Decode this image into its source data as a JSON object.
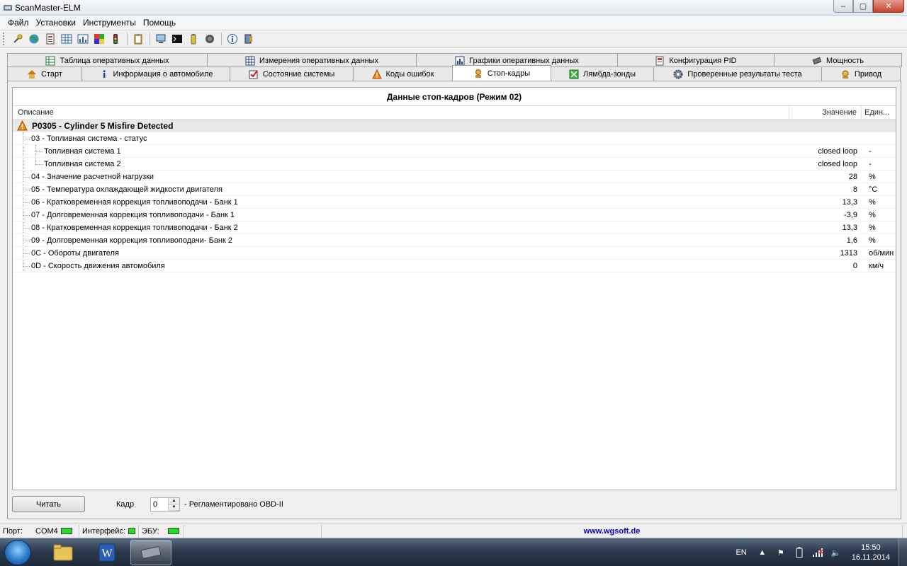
{
  "window": {
    "title": "ScanMaster-ELM",
    "minimize_glyph": "–",
    "restore_glyph": "▢",
    "close_glyph": "✕"
  },
  "menu": [
    "Файл",
    "Установки",
    "Инструменты",
    "Помощь"
  ],
  "toolbar_icons": [
    "connect-icon",
    "globe-icon",
    "report-icon",
    "table-icon",
    "chart-icon",
    "palette-icon",
    "traffic-light-icon",
    "clipboard-icon",
    "pc-icon",
    "terminal-icon",
    "battery-icon",
    "record-icon",
    "info-icon",
    "exit-icon"
  ],
  "tabs": {
    "row1": [
      {
        "label": "Таблица оперативных данных",
        "icon": "table-icon"
      },
      {
        "label": "Измерения оперативных данных",
        "icon": "grid-icon"
      },
      {
        "label": "Графики оперативных данных",
        "icon": "chart-icon"
      },
      {
        "label": "Конфигурация PID",
        "icon": "config-icon"
      },
      {
        "label": "Мощность",
        "icon": "chip-icon"
      }
    ],
    "row2": [
      {
        "label": "Старт",
        "icon": "home-icon"
      },
      {
        "label": "Информация о автомобиле",
        "icon": "info-icon"
      },
      {
        "label": "Состояние системы",
        "icon": "status-icon"
      },
      {
        "label": "Коды ошибок",
        "icon": "warning-icon"
      },
      {
        "label": "Стоп-кадры",
        "icon": "freeze-icon"
      },
      {
        "label": "Лямбда-зонды",
        "icon": "lambda-icon"
      },
      {
        "label": "Проверенные результаты теста",
        "icon": "gear-icon"
      },
      {
        "label": "Привод",
        "icon": "drive-icon"
      }
    ]
  },
  "freeze_frame": {
    "title": "Данные стоп-кадров (Режим 02)",
    "columns": {
      "description": "Описание",
      "value": "Значение",
      "unit": "Един..."
    },
    "dtc": "P0305 - Cylinder 5 Misfire Detected",
    "rows": [
      {
        "desc": "03 - Топливная система - статус",
        "value": "",
        "unit": "",
        "level": 1
      },
      {
        "desc": "Топливная система 1",
        "value": "closed loop",
        "unit": "-",
        "level": 2
      },
      {
        "desc": "Топливная система 2",
        "value": "closed loop",
        "unit": "-",
        "level": 2
      },
      {
        "desc": "04 - Значение расчетной нагрузки",
        "value": "28",
        "unit": "%",
        "level": 1
      },
      {
        "desc": "05 - Температура охлаждающей жидкости двигателя",
        "value": "8",
        "unit": "°C",
        "level": 1
      },
      {
        "desc": "06 - Кратковременная коррекция топливоподачи - Банк 1",
        "value": "13,3",
        "unit": "%",
        "level": 1
      },
      {
        "desc": "07 - Долговременная коррекция топливоподачи - Банк 1",
        "value": "-3,9",
        "unit": "%",
        "level": 1
      },
      {
        "desc": "08 - Кратковременная коррекция топливоподачи - Банк 2",
        "value": "13,3",
        "unit": "%",
        "level": 1
      },
      {
        "desc": "09 - Долговременная коррекция топливоподачи- Банк 2",
        "value": "1,6",
        "unit": "%",
        "level": 1
      },
      {
        "desc": "0C - Обороты двигателя",
        "value": "1313",
        "unit": "об/мин",
        "level": 1
      },
      {
        "desc": "0D - Скорость движения автомобиля",
        "value": "0",
        "unit": "км/ч",
        "level": 1
      }
    ]
  },
  "controls": {
    "read_button": "Читать",
    "frame_label": "Кадр",
    "frame_value": "0",
    "regulated_text": "- Регламентировано OBD-II"
  },
  "statusbar": {
    "port_label": "Порт:",
    "port_value": "COM4",
    "interface_label": "Интерфейс:",
    "ecu_label": "ЭБУ:",
    "url": "www.wgsoft.de",
    "led_color": "#22dd22"
  },
  "taskbar": {
    "lang": "EN",
    "time": "15:50",
    "date": "16.11.2014"
  }
}
